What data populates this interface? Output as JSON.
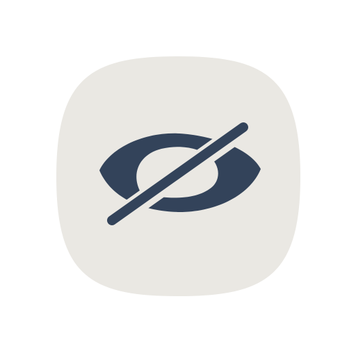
{
  "app_icon": {
    "icon_name": "eye-off-icon",
    "background_color": "#EAE8E3",
    "glyph_color": "#33435A"
  }
}
